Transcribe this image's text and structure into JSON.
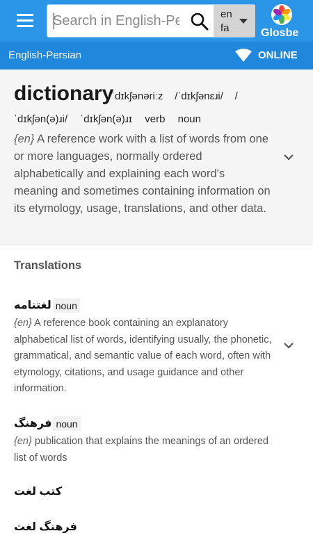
{
  "appbar": {
    "search_placeholder": "Search in English-Persian",
    "lang_from": "en",
    "lang_to": "fa",
    "brand": "Glosbe"
  },
  "subbar": {
    "language_pair": "English-Persian",
    "status": "ONLINE"
  },
  "entry": {
    "headword": "dictionary",
    "ipa_1": "ˈdɪkʃənəriːz",
    "ipa_2": "/ˈdɪkʃənɛɹi/",
    "ipa_sep": "/",
    "ipa_3": "ˈdɪkʃən(ə)ɹi/",
    "ipa_4": "ˈdɪkʃən(ə)ɹɪ",
    "pos_1": "verb",
    "pos_2": "noun",
    "def_lang": "{en}",
    "definition": "A reference work with a list of words from one or more languages, normally ordered alphabetically and explaining each word's meaning and sometimes containing information on its etymology, usage, translations, and other data."
  },
  "translations": {
    "title": "Translations",
    "items": [
      {
        "term": "لغتنامه",
        "pos": "noun",
        "def_lang": "{en}",
        "definition": "A reference book containing an explanatory alphabetical list of words, identifying usually, the phonetic, grammatical, and semantic value of each word, often with etymology, citations, and usage guidance and other information."
      },
      {
        "term": "فرهنگ",
        "pos": "noun",
        "def_lang": "{en}",
        "definition": "publication that explains the meanings of an ordered list of words"
      },
      {
        "term": "کتب لغت"
      },
      {
        "term": "فرهنگ لغت"
      }
    ]
  },
  "colors": {
    "appbar": "#2b95e8",
    "subbar": "#1f87dc",
    "entry_bg": "#f5f5f5"
  }
}
